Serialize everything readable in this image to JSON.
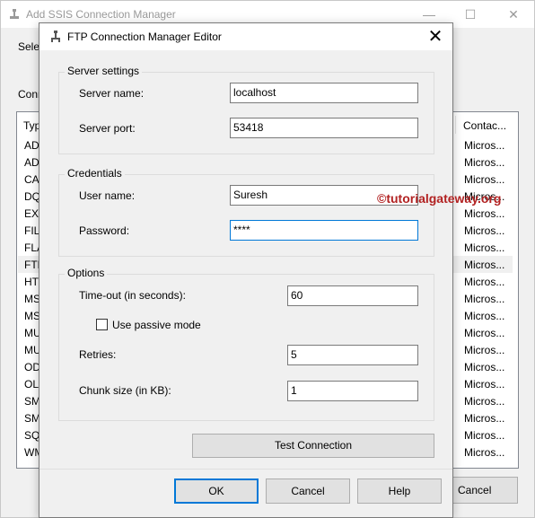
{
  "background_window": {
    "title": "Add SSIS Connection Manager",
    "select_label": "Select",
    "connection_label": "Connection",
    "columns": [
      "Type",
      "Contac..."
    ],
    "rows": [
      {
        "type": "ADO",
        "contact": "Micros..."
      },
      {
        "type": "ADO",
        "contact": "Micros..."
      },
      {
        "type": "CAC",
        "contact": "Micros..."
      },
      {
        "type": "DQ",
        "contact": "Micros..."
      },
      {
        "type": "EXC",
        "contact": "Micros..."
      },
      {
        "type": "FILE",
        "contact": "Micros..."
      },
      {
        "type": "FLA",
        "contact": "Micros..."
      },
      {
        "type": "FTP",
        "contact": "Micros...",
        "selected": true
      },
      {
        "type": "HTT",
        "contact": "Micros..."
      },
      {
        "type": "MS",
        "contact": "Micros..."
      },
      {
        "type": "MS",
        "contact": "Micros..."
      },
      {
        "type": "MU",
        "contact": "Micros..."
      },
      {
        "type": "MU",
        "contact": "Micros..."
      },
      {
        "type": "OD",
        "contact": "Micros..."
      },
      {
        "type": "OLE",
        "contact": "Micros..."
      },
      {
        "type": "SM",
        "contact": "Micros..."
      },
      {
        "type": "SM",
        "contact": "Micros..."
      },
      {
        "type": "SQL",
        "contact": "Micros..."
      },
      {
        "type": "WM",
        "contact": "Micros..."
      }
    ],
    "cancel_label": "Cancel"
  },
  "dialog": {
    "title": "FTP Connection Manager Editor",
    "server_settings": {
      "group_label": "Server settings",
      "server_name_label": "Server name:",
      "server_name_value": "localhost",
      "server_port_label": "Server port:",
      "server_port_value": "53418"
    },
    "credentials": {
      "group_label": "Credentials",
      "user_name_label": "User name:",
      "user_name_value": "Suresh",
      "password_label": "Password:",
      "password_value": "****"
    },
    "options": {
      "group_label": "Options",
      "timeout_label": "Time-out (in seconds):",
      "timeout_value": "60",
      "passive_mode_label": "Use passive mode",
      "passive_mode_checked": false,
      "retries_label": "Retries:",
      "retries_value": "5",
      "chunk_size_label": "Chunk size (in KB):",
      "chunk_size_value": "1"
    },
    "test_connection_label": "Test Connection",
    "ok_label": "OK",
    "cancel_label": "Cancel",
    "help_label": "Help"
  },
  "watermark": "©tutorialgateway.org",
  "colors": {
    "focus_border": "#0078d7",
    "watermark": "#b22222",
    "dialog_bg": "#f0f0f0"
  }
}
